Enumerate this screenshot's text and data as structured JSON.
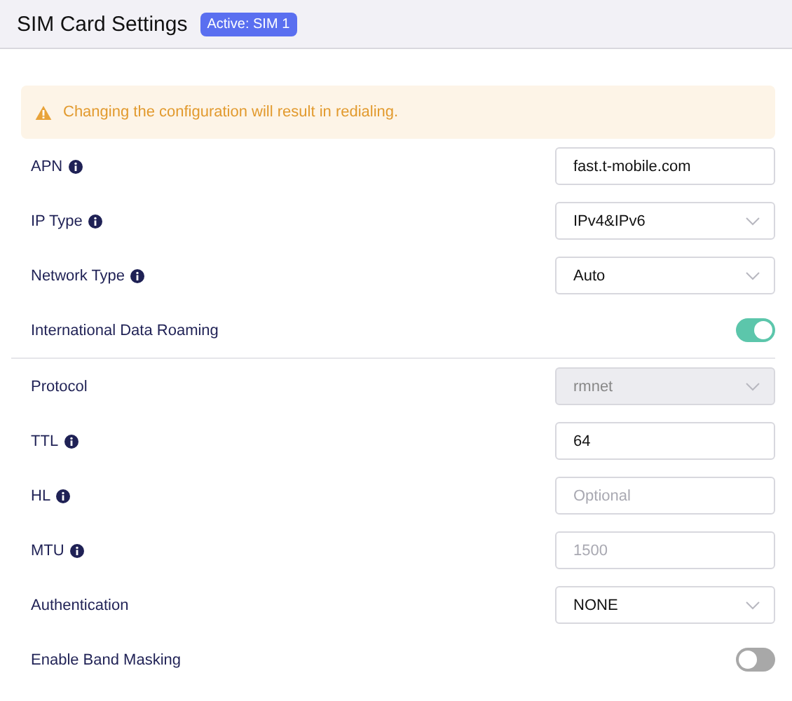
{
  "header": {
    "title": "SIM Card Settings",
    "badge": "Active: SIM 1"
  },
  "alert": {
    "text": "Changing the configuration will result in redialing."
  },
  "rows": [
    {
      "kind": "input",
      "label": "APN",
      "info": true,
      "value": "fast.t-mobile.com",
      "divider_below": false
    },
    {
      "kind": "select",
      "label": "IP Type",
      "info": true,
      "value": "IPv4&IPv6",
      "disabled": false,
      "divider_below": false
    },
    {
      "kind": "select",
      "label": "Network Type",
      "info": true,
      "value": "Auto",
      "disabled": false,
      "divider_below": false
    },
    {
      "kind": "toggle",
      "label": "International Data Roaming",
      "info": false,
      "on": true,
      "divider_below": true
    },
    {
      "kind": "select",
      "label": "Protocol",
      "info": false,
      "value": "rmnet",
      "disabled": true,
      "divider_below": false
    },
    {
      "kind": "input",
      "label": "TTL",
      "info": true,
      "value": "64",
      "divider_below": false
    },
    {
      "kind": "input",
      "label": "HL",
      "info": true,
      "placeholder": "Optional",
      "divider_below": false
    },
    {
      "kind": "input",
      "label": "MTU",
      "info": true,
      "placeholder": "1500",
      "divider_below": false
    },
    {
      "kind": "select",
      "label": "Authentication",
      "info": false,
      "value": "NONE",
      "disabled": false,
      "divider_below": false
    },
    {
      "kind": "toggle",
      "label": "Enable Band Masking",
      "info": false,
      "on": false,
      "divider_below": false
    }
  ]
}
